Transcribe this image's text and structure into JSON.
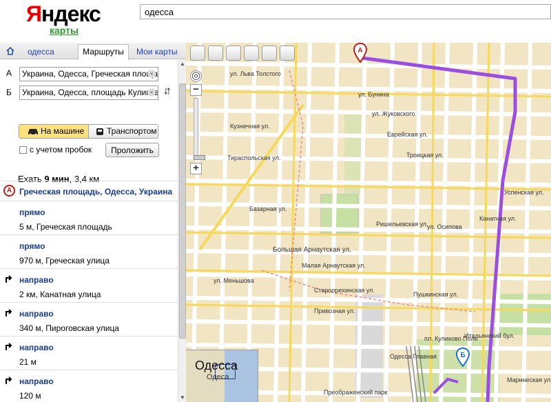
{
  "header": {
    "logo_first": "Я",
    "logo_rest": "ндекс",
    "logo_sub": "карты",
    "search_value": "одесса"
  },
  "tabs": {
    "home": "одесса",
    "routes": "Маршруты",
    "my_maps": "Мои карты"
  },
  "route": {
    "label_a": "А",
    "label_b": "Б",
    "from": "Украина, Одесса, Греческая площадь",
    "to": "Украина, Одесса, площадь Куликово поле",
    "mode_car": "На машине",
    "mode_transit": "Транспортом",
    "traffic_label": "с учетом пробок",
    "build_button": "Проложить",
    "summary_prefix": "Ехать",
    "summary_time": "9 мин",
    "summary_dist": ", 3,4 км"
  },
  "steps": {
    "start_marker": "A",
    "start": "Греческая площадь, Одесса, Украина",
    "items": [
      {
        "action": "прямо",
        "detail": "5 м, Греческая площадь",
        "turn": "straight"
      },
      {
        "action": "прямо",
        "detail": "970 м, Греческая улица",
        "turn": "straight"
      },
      {
        "action": "направо",
        "detail": "2 км, Канатная улица",
        "turn": "right"
      },
      {
        "action": "направо",
        "detail": "340 м, Пироговская улица",
        "turn": "right"
      },
      {
        "action": "направо",
        "detail": "21 м",
        "turn": "right"
      },
      {
        "action": "направо",
        "detail": "120 м",
        "turn": "right"
      }
    ]
  },
  "map": {
    "marker_a": "А",
    "marker_b": "Б",
    "minimap_title": "Одесса",
    "minimap_sub": "Одеса",
    "route_color": "#9b4fe0",
    "labels": [
      "ул. Бунина",
      "ул. Жуковского",
      "Троицкая ул.",
      "Базарная ул.",
      "Большая Арнаутская ул.",
      "Малая Арнаутская ул.",
      "Староорехинская ул.",
      "Привозная ул.",
      "Успенская ул.",
      "Тираспольская ул.",
      "Канатная ул.",
      "Итальянский бул.",
      "Еврейская ул.",
      "Пушкинская ул.",
      "Ришельевская ул.",
      "ул. Осипова",
      "Кузнечная ул.",
      "ул. Льва Толстого",
      "ул. Меньшова",
      "Преображенский парк",
      "Одесса Главная",
      "пл. Куликово Поле",
      "Маринеская ул."
    ]
  }
}
